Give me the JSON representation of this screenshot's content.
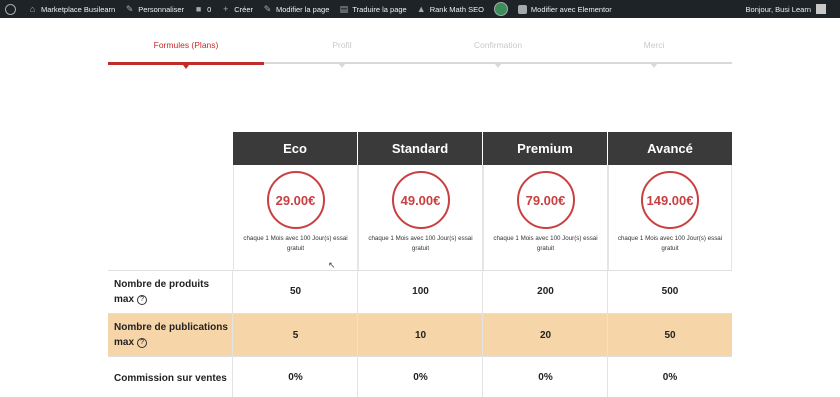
{
  "adminbar": {
    "site": "Marketplace Busilearn",
    "customize": "Personnaliser",
    "comments": "0",
    "new": "Créer",
    "edit_page": "Modifier la page",
    "translate": "Traduire la page",
    "rankmath": "Rank Math SEO",
    "elementor": "Modifier avec Elementor",
    "greeting": "Bonjour, Busi Learn"
  },
  "steps": [
    {
      "label": "Formules (Plans)",
      "active": true
    },
    {
      "label": "Profil",
      "active": false
    },
    {
      "label": "Confirmation",
      "active": false
    },
    {
      "label": "Merci",
      "active": false
    }
  ],
  "plans": [
    {
      "name": "Eco",
      "price": "29.00€",
      "note": "chaque 1 Mois avec 100 Jour(s) essai gratuit"
    },
    {
      "name": "Standard",
      "price": "49.00€",
      "note": "chaque 1 Mois avec 100 Jour(s) essai gratuit"
    },
    {
      "name": "Premium",
      "price": "79.00€",
      "note": "chaque 1 Mois avec 100 Jour(s) essai gratuit"
    },
    {
      "name": "Avancé",
      "price": "149.00€",
      "note": "chaque 1 Mois avec 100 Jour(s) essai gratuit"
    }
  ],
  "rows": [
    {
      "label_line1": "Nombre de produits",
      "label_line2": "max",
      "help": "?",
      "values": [
        "50",
        "100",
        "200",
        "500"
      ]
    },
    {
      "label_line1": "Nombre de publications",
      "label_line2": "max",
      "help": "?",
      "values": [
        "5",
        "10",
        "20",
        "50"
      ]
    },
    {
      "label_line1": "Commission sur ventes",
      "label_line2": "",
      "help": "",
      "values": [
        "0%",
        "0%",
        "0%",
        "0%"
      ]
    }
  ],
  "colors": {
    "accent": "#c32b2b",
    "header_bg": "#3a3a3a",
    "alt_row": "#f6d5a9",
    "adminbar": "#1d2327"
  }
}
